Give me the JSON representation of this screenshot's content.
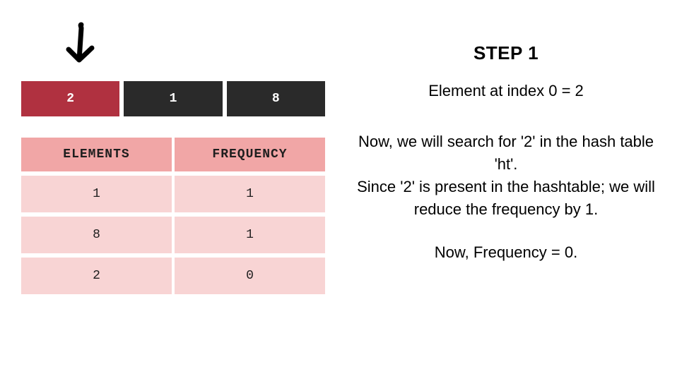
{
  "step_title": "STEP 1",
  "array": {
    "cells": [
      {
        "value": "2",
        "active": true
      },
      {
        "value": "1",
        "active": false
      },
      {
        "value": "8",
        "active": false
      }
    ]
  },
  "table": {
    "headers": {
      "elements": "ELEMENTS",
      "frequency": "FREQUENCY"
    },
    "rows": [
      {
        "element": "1",
        "frequency": "1"
      },
      {
        "element": "8",
        "frequency": "1"
      },
      {
        "element": "2",
        "frequency": "0"
      }
    ]
  },
  "description": {
    "line1": "Element at index 0 = 2",
    "line2": "Now, we will search for '2' in the hash table 'ht'.",
    "line3": "Since '2' is present in the hashtable; we will reduce the frequency by 1.",
    "line4": "Now, Frequency = 0."
  },
  "colors": {
    "active_cell": "#b03140",
    "dark_cell": "#2a2a2a",
    "header_bg": "#f1a6a6",
    "row_bg": "#f8d4d4"
  }
}
